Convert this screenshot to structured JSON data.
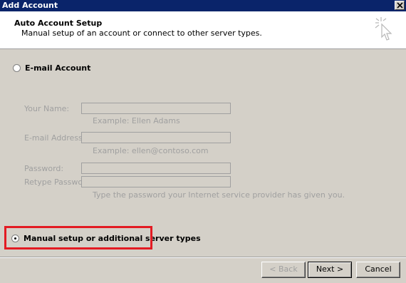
{
  "window": {
    "title": "Add Account"
  },
  "header": {
    "title": "Auto Account Setup",
    "subtitle": "Manual setup of an account or connect to other server types."
  },
  "options": {
    "email_account_label": "E-mail Account",
    "manual_setup_label": "Manual setup or additional server types",
    "selected": "manual_setup"
  },
  "form": {
    "name_label": "Your Name:",
    "name_value": "",
    "name_hint": "Example: Ellen Adams",
    "email_label": "E-mail Address:",
    "email_value": "",
    "email_hint": "Example: ellen@contoso.com",
    "password_label": "Password:",
    "password_value": "",
    "retype_label": "Retype Password:",
    "retype_value": "",
    "password_hint": "Type the password your Internet service provider has given you."
  },
  "buttons": {
    "back": "< Back",
    "next": "Next >",
    "cancel": "Cancel"
  },
  "icons": {
    "close": "close-icon",
    "wizard": "cursor-sparkle-icon"
  },
  "colors": {
    "titlebar": "#0a246a",
    "highlight": "#e31b23",
    "dialog": "#d4d0c8"
  }
}
